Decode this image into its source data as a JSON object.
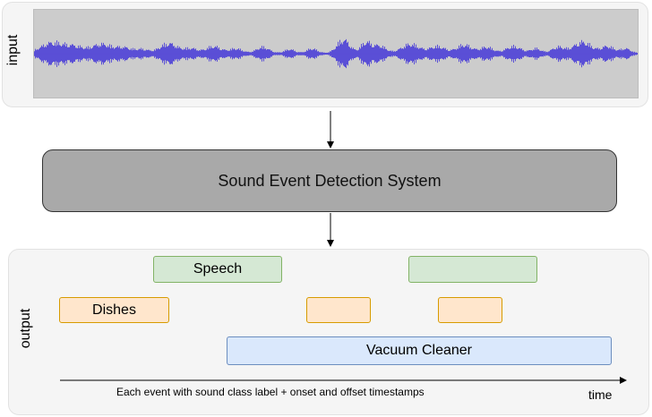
{
  "input_panel": {
    "label": "input"
  },
  "system": {
    "title": "Sound Event Detection System"
  },
  "output_panel": {
    "label": "output",
    "events": [
      {
        "name": "speech-1",
        "label": "Speech",
        "class": "green"
      },
      {
        "name": "speech-2",
        "label": "",
        "class": "green"
      },
      {
        "name": "dishes-1",
        "label": "Dishes",
        "class": "orange"
      },
      {
        "name": "dishes-2",
        "label": "",
        "class": "orange"
      },
      {
        "name": "dishes-3",
        "label": "",
        "class": "orange"
      },
      {
        "name": "vacuum-1",
        "label": "Vacuum Cleaner",
        "class": "blue"
      }
    ],
    "caption": "Each event with sound class label + onset and offset timestamps",
    "time_axis_label": "time"
  },
  "colors": {
    "waveform": "#5a4fd6",
    "speech": "#d5e8d4",
    "dishes": "#ffe6cc",
    "vacuum": "#dae8fc",
    "system": "#a9a9a9"
  }
}
